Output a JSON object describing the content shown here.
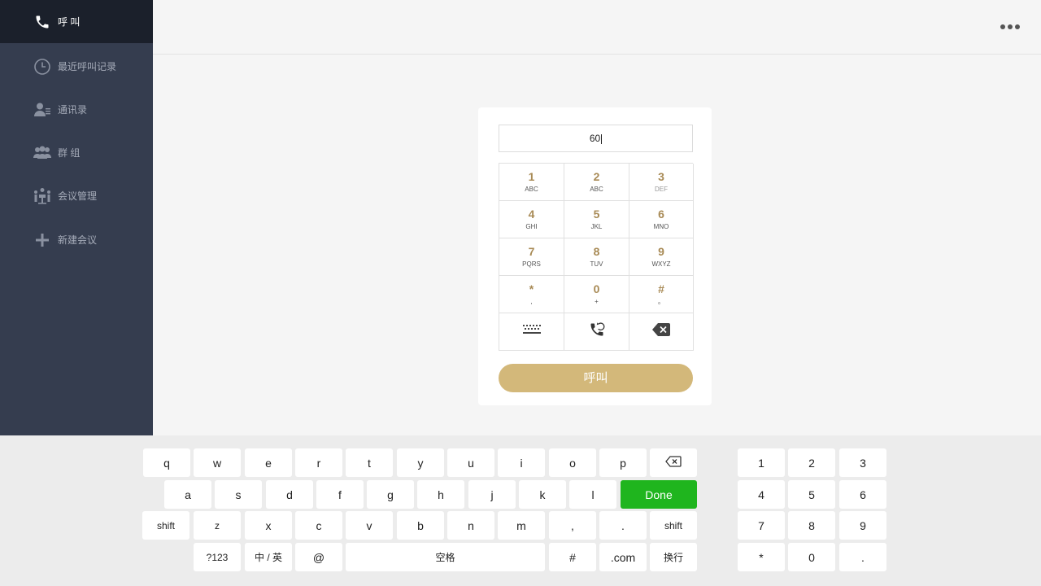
{
  "sidebar": {
    "items": [
      {
        "label": "呼 叫",
        "icon": "phone-icon"
      },
      {
        "label": "最近呼叫记录",
        "icon": "clock-icon"
      },
      {
        "label": "通讯录",
        "icon": "contacts-icon"
      },
      {
        "label": "群 组",
        "icon": "group-icon"
      },
      {
        "label": "会议管理",
        "icon": "meeting-icon"
      },
      {
        "label": "新建会议",
        "icon": "plus-icon"
      }
    ]
  },
  "header": {
    "more_icon": "more-icon"
  },
  "dialer": {
    "input_value": "60",
    "keys": [
      {
        "digit": "1",
        "letters": "ABC"
      },
      {
        "digit": "2",
        "letters": "ABC"
      },
      {
        "digit": "3",
        "letters": "DEF"
      },
      {
        "digit": "4",
        "letters": "GHI"
      },
      {
        "digit": "5",
        "letters": "JKL"
      },
      {
        "digit": "6",
        "letters": "MNO"
      },
      {
        "digit": "7",
        "letters": "PQRS"
      },
      {
        "digit": "8",
        "letters": "TUV"
      },
      {
        "digit": "9",
        "letters": "WXYZ"
      },
      {
        "digit": "*",
        "letters": ","
      },
      {
        "digit": "0",
        "letters": "+"
      },
      {
        "digit": "#",
        "letters": "。"
      }
    ],
    "bottom_icons": [
      "keyboard-icon",
      "redial-icon",
      "backspace-icon"
    ],
    "call_label": "呼叫"
  },
  "keyboard": {
    "row1": [
      "q",
      "w",
      "e",
      "r",
      "t",
      "y",
      "u",
      "i",
      "o",
      "p"
    ],
    "row2": [
      "a",
      "s",
      "d",
      "f",
      "g",
      "h",
      "j",
      "k",
      "l"
    ],
    "done": "Done",
    "row3": [
      "shift",
      "z",
      "x",
      "c",
      "v",
      "b",
      "n",
      "m",
      ",",
      ".",
      "shift"
    ],
    "row4": {
      "sym": "?123",
      "lang": "中 / 英",
      "at": "@",
      "space": "空格",
      "hash": "#",
      "com": ".com",
      "enter": "换行"
    },
    "numpad": [
      "1",
      "2",
      "3",
      "4",
      "5",
      "6",
      "7",
      "8",
      "9",
      "*",
      "0",
      "."
    ]
  },
  "colors": {
    "sidebar": "#353d4f",
    "sidebar_active": "#1b202b",
    "accent": "#d3b87a",
    "digit": "#a88a55",
    "done": "#1fb51e"
  }
}
